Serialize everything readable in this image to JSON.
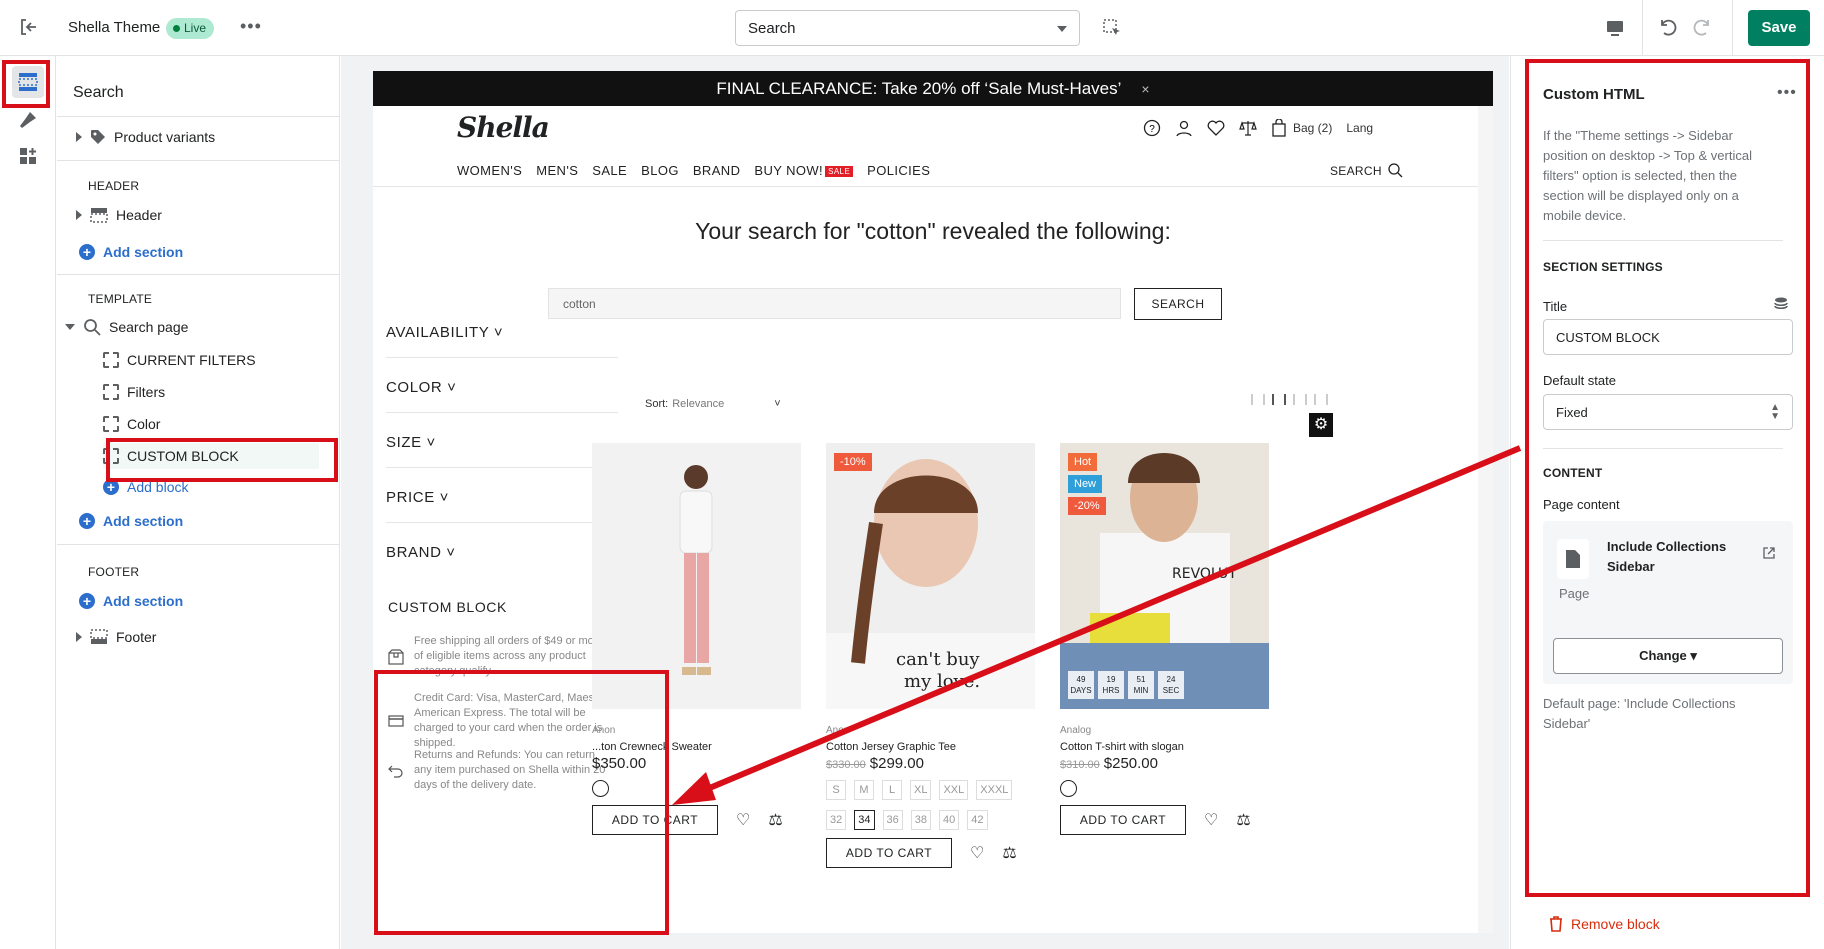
{
  "topbar": {
    "theme_name": "Shella Theme",
    "status": "Live",
    "page_select": "Search",
    "save_label": "Save"
  },
  "left_panel": {
    "title": "Search",
    "product_variants": "Product variants",
    "header_caption": "HEADER",
    "header_item": "Header",
    "add_section": "Add section",
    "template_caption": "TEMPLATE",
    "search_page": "Search page",
    "blocks": [
      "CURRENT FILTERS",
      "Filters",
      "Color",
      "CUSTOM BLOCK"
    ],
    "add_block": "Add block",
    "footer_caption": "FOOTER",
    "footer_item": "Footer"
  },
  "store": {
    "announcement": "FINAL CLEARANCE: Take 20% off ‘Sale Must-Haves’",
    "close": "×",
    "logo": "Shella",
    "bag": "Bag (2)",
    "lang": "Lang",
    "menu": [
      "WOMEN'S",
      "MEN'S",
      "SALE",
      "BLOG",
      "BRAND",
      "BUY NOW!",
      "POLICIES"
    ],
    "sale_badge": "SALE",
    "search_link": "SEARCH",
    "headline": "Your search for \"cotton\" revealed the following:",
    "search_value": "cotton",
    "search_button": "SEARCH",
    "filters": [
      "AVAILABILITY",
      "COLOR",
      "SIZE",
      "PRICE",
      "BRAND"
    ],
    "custom_block_title": "CUSTOM BLOCK",
    "custom_block_items": [
      "Free shipping all orders of $49 or more of eligible items across any product category qualify.",
      "Credit Card: Visa, MasterCard, Maestro, American Express. The total will be charged to your card when the order is shipped.",
      "Returns and Refunds: You can return any item purchased on Shella within 20 days of the delivery date."
    ],
    "sort_label": "Sort:",
    "sort_value": "Relevance",
    "add_to_cart": "ADD TO CART",
    "products": [
      {
        "brand": "Anon",
        "name": "...ton Crewneck Sweater",
        "old_price": "",
        "price": "$350.00",
        "badges": []
      },
      {
        "brand": "Anon",
        "name": "Cotton Jersey Graphic Tee",
        "old_price": "$330.00",
        "price": "$299.00",
        "badges": [
          "-10%"
        ]
      },
      {
        "brand": "Analog",
        "name": "Cotton T-shirt with slogan",
        "old_price": "$310.00",
        "price": "$250.00",
        "badges": [
          "Hot",
          "New",
          "-20%"
        ]
      }
    ],
    "sizes_row1": [
      "S",
      "M",
      "L",
      "XL",
      "XXL",
      "XXXL"
    ],
    "sizes_row2": [
      "32",
      "34",
      "36",
      "38",
      "40",
      "42"
    ],
    "countdown": [
      [
        "49",
        "DAYS"
      ],
      [
        "19",
        "HRS"
      ],
      [
        "51",
        "MIN"
      ],
      [
        "24",
        "SEC"
      ]
    ]
  },
  "right_panel": {
    "title": "Custom HTML",
    "info": "If the \"Theme settings -> Sidebar position on desktop -> Top & vertical filters\" option is selected, then the section will be displayed only on a mobile device.",
    "section_settings": "SECTION SETTINGS",
    "title_label": "Title",
    "title_value": "CUSTOM BLOCK",
    "default_state_label": "Default state",
    "default_state_value": "Fixed",
    "content_caption": "CONTENT",
    "page_content_label": "Page content",
    "page_name": "Include Collections Sidebar",
    "page_type": "Page",
    "change_label": "Change",
    "default_page": "Default page: 'Include Collections Sidebar'",
    "remove_block": "Remove block"
  },
  "colors": {
    "accent": "#2c6ecb",
    "save": "#008060",
    "highlight": "#d80f18",
    "danger": "#d72c0d"
  }
}
